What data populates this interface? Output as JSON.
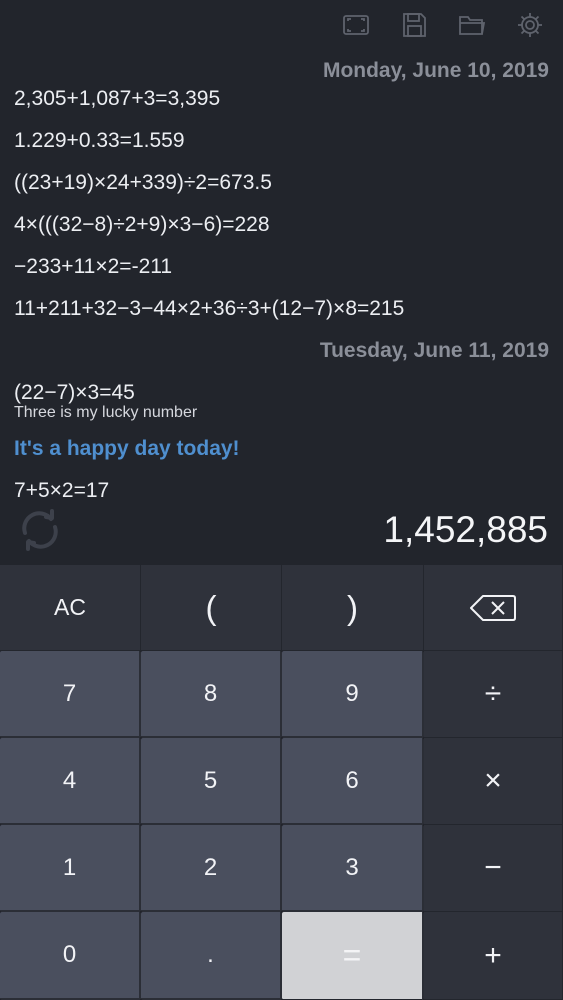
{
  "toolbar": {
    "icons": [
      "fullscreen-icon",
      "save-icon",
      "folder-icon",
      "settings-icon"
    ]
  },
  "history": {
    "date1": "Monday, June 10, 2019",
    "entries1": [
      "2,305+1,087+3=3,395",
      "1.229+0.33=1.559",
      "((23+19)×24+339)÷2=673.5",
      "4×(((32−8)÷2+9)×3−6)=228",
      "−233+11×2=-211",
      "11+211+32−3−44×2+36÷3+(12−7)×8=215"
    ],
    "date2": "Tuesday, June 11, 2019",
    "entry2a": "(22−7)×3=45",
    "note2a": "Three is my lucky number",
    "comment": "It's a happy day today!",
    "entry2b": "7+5×2=17"
  },
  "display": {
    "result": "1,452,885"
  },
  "keys": {
    "ac": "AC",
    "lparen": "(",
    "rparen": ")",
    "k7": "7",
    "k8": "8",
    "k9": "9",
    "div": "÷",
    "k4": "4",
    "k5": "5",
    "k6": "6",
    "mul": "×",
    "k1": "1",
    "k2": "2",
    "k3": "3",
    "sub": "−",
    "k0": "0",
    "dot": ".",
    "eq": "=",
    "add": "+"
  },
  "colors": {
    "background": "#22252c",
    "date_text": "#8b8f99",
    "comment_text": "#4f8fcf",
    "number_key": "#4a4f5e",
    "function_key": "#2f323b",
    "equals_key": "#d1d2d5"
  }
}
